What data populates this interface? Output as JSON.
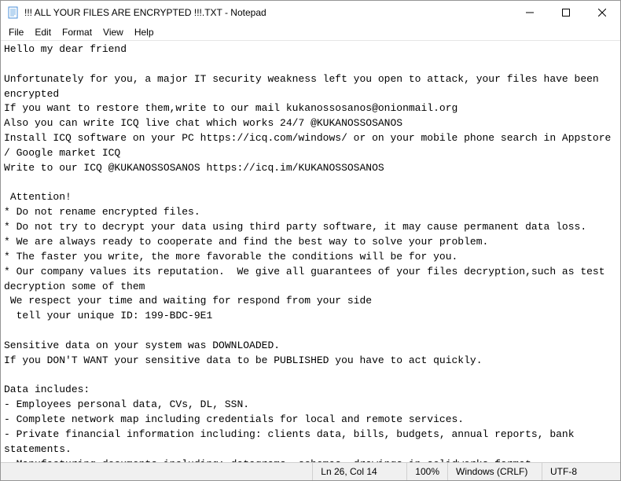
{
  "titlebar": {
    "title": "!!! ALL YOUR FILES ARE ENCRYPTED !!!.TXT - Notepad"
  },
  "window_controls": {
    "minimize": "─",
    "maximize": "☐",
    "close": "✕"
  },
  "menubar": {
    "items": [
      {
        "label": "File"
      },
      {
        "label": "Edit"
      },
      {
        "label": "Format"
      },
      {
        "label": "View"
      },
      {
        "label": "Help"
      }
    ]
  },
  "editor": {
    "content": "Hello my dear friend\n\nUnfortunately for you, a major IT security weakness left you open to attack, your files have been encrypted\nIf you want to restore them,write to our mail kukanossosanos@onionmail.org\nAlso you can write ICQ live chat which works 24/7 @KUKANOSSOSANOS\nInstall ICQ software on your PC https://icq.com/windows/ or on your mobile phone search in Appstore / Google market ICQ\nWrite to our ICQ @KUKANOSSOSANOS https://icq.im/KUKANOSSOSANOS\n\n Attention!\n* Do not rename encrypted files.\n* Do not try to decrypt your data using third party software, it may cause permanent data loss.\n* We are always ready to cooperate and find the best way to solve your problem.\n* The faster you write, the more favorable the conditions will be for you.\n* Our company values its reputation.  We give all guarantees of your files decryption,such as test decryption some of them\n We respect your time and waiting for respond from your side\n  tell your unique ID: 199-BDC-9E1\n\nSensitive data on your system was DOWNLOADED.\nIf you DON'T WANT your sensitive data to be PUBLISHED you have to act quickly.\n\nData includes:\n- Employees personal data, CVs, DL, SSN.\n- Complete network map including credentials for local and remote services.\n- Private financial information including: clients data, bills, budgets, annual reports, bank statements.\n- Manufacturing documents including: datagrams, schemas, drawings in solidworks format\n- And more..."
  },
  "statusbar": {
    "position": "Ln 26, Col 14",
    "zoom": "100%",
    "line_ending": "Windows (CRLF)",
    "encoding": "UTF-8"
  }
}
